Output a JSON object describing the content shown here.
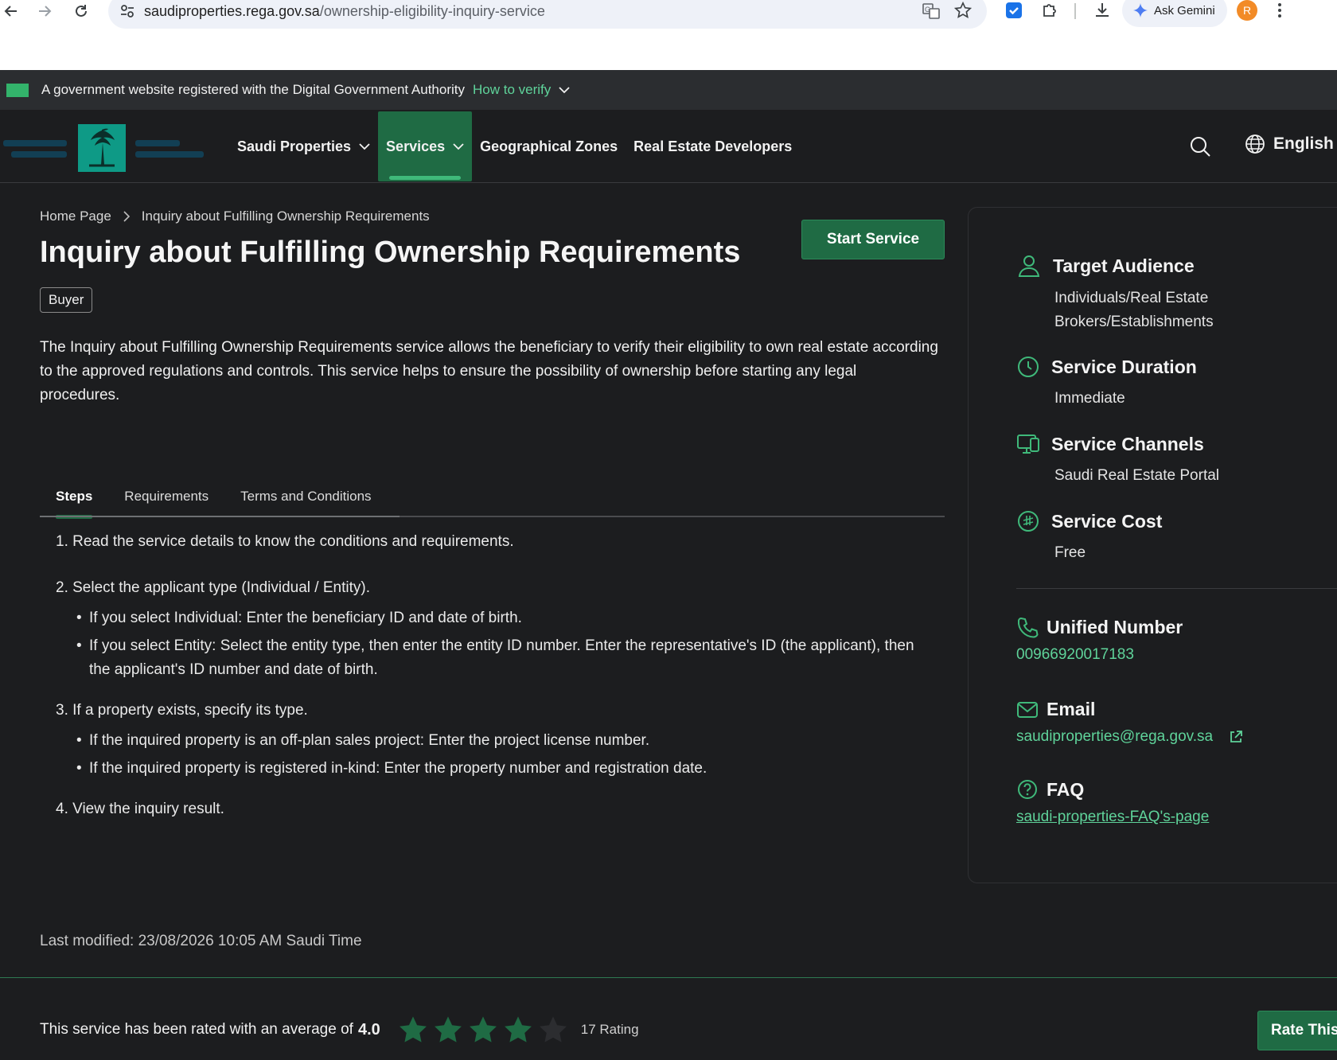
{
  "browser": {
    "url_host": "saudiproperties.rega.gov.sa",
    "url_path": "/ownership-eligibility-inquiry-service",
    "gemini_label": "Ask Gemini",
    "profile_initial": "R"
  },
  "gov_banner": {
    "text": "A government website registered with the Digital Government Authority",
    "verify_label": "How to verify"
  },
  "nav": {
    "items": [
      {
        "label": "Saudi Properties"
      },
      {
        "label": "Services"
      },
      {
        "label": "Geographical Zones"
      },
      {
        "label": "Real Estate Developers"
      }
    ],
    "language": "English"
  },
  "breadcrumb": {
    "home": "Home Page",
    "current": "Inquiry about Fulfilling Ownership Requirements"
  },
  "page": {
    "title": "Inquiry about Fulfilling Ownership Requirements",
    "start_button": "Start Service",
    "badge": "Buyer",
    "description": "The Inquiry about Fulfilling Ownership Requirements service allows the beneficiary to verify their eligibility to own real estate according to the approved regulations and controls. This service helps to ensure the possibility of ownership before starting any legal procedures."
  },
  "tabs": [
    {
      "label": "Steps"
    },
    {
      "label": "Requirements"
    },
    {
      "label": "Terms and Conditions"
    }
  ],
  "steps": [
    {
      "text": "1. Read the service details to know the conditions and requirements.",
      "bullets": []
    },
    {
      "text": "2. Select the applicant type (Individual / Entity).",
      "bullets": [
        "If you select Individual: Enter the beneficiary ID and date of birth.",
        "If you select Entity: Select the entity type, then enter the entity ID number. Enter the representative's ID (the applicant), then the applicant's ID number and date of birth."
      ]
    },
    {
      "text": "3. If a property exists, specify its type.",
      "bullets": [
        "If the inquired property is an off-plan sales project: Enter the project license number.",
        "If the inquired property is registered in-kind: Enter the property number and registration date."
      ]
    },
    {
      "text": "4. View the inquiry result.",
      "bullets": []
    }
  ],
  "last_modified": "Last modified: 23/08/2026 10:05 AM Saudi Time",
  "rating": {
    "text": "This service has been rated with an average of",
    "average": "4.0",
    "stars_filled": 4,
    "stars_total": 5,
    "count": "17 Rating",
    "button": "Rate This"
  },
  "side_panel": {
    "target_audience": {
      "label": "Target Audience",
      "value": "Individuals/Real Estate Brokers/Establishments"
    },
    "service_duration": {
      "label": "Service Duration",
      "value": "Immediate"
    },
    "service_channels": {
      "label": "Service Channels",
      "value": "Saudi Real Estate Portal"
    },
    "service_cost": {
      "label": "Service Cost",
      "value": "Free"
    },
    "unified_number": {
      "label": "Unified Number",
      "value": "00966920017183"
    },
    "email": {
      "label": "Email",
      "value": "saudiproperties@rega.gov.sa"
    },
    "faq": {
      "label": "FAQ",
      "value": "saudi-properties-FAQ's-page"
    }
  },
  "colors": {
    "accent_green": "#1f6b44",
    "link_green": "#5fd39a",
    "background": "#1c1d1f"
  }
}
